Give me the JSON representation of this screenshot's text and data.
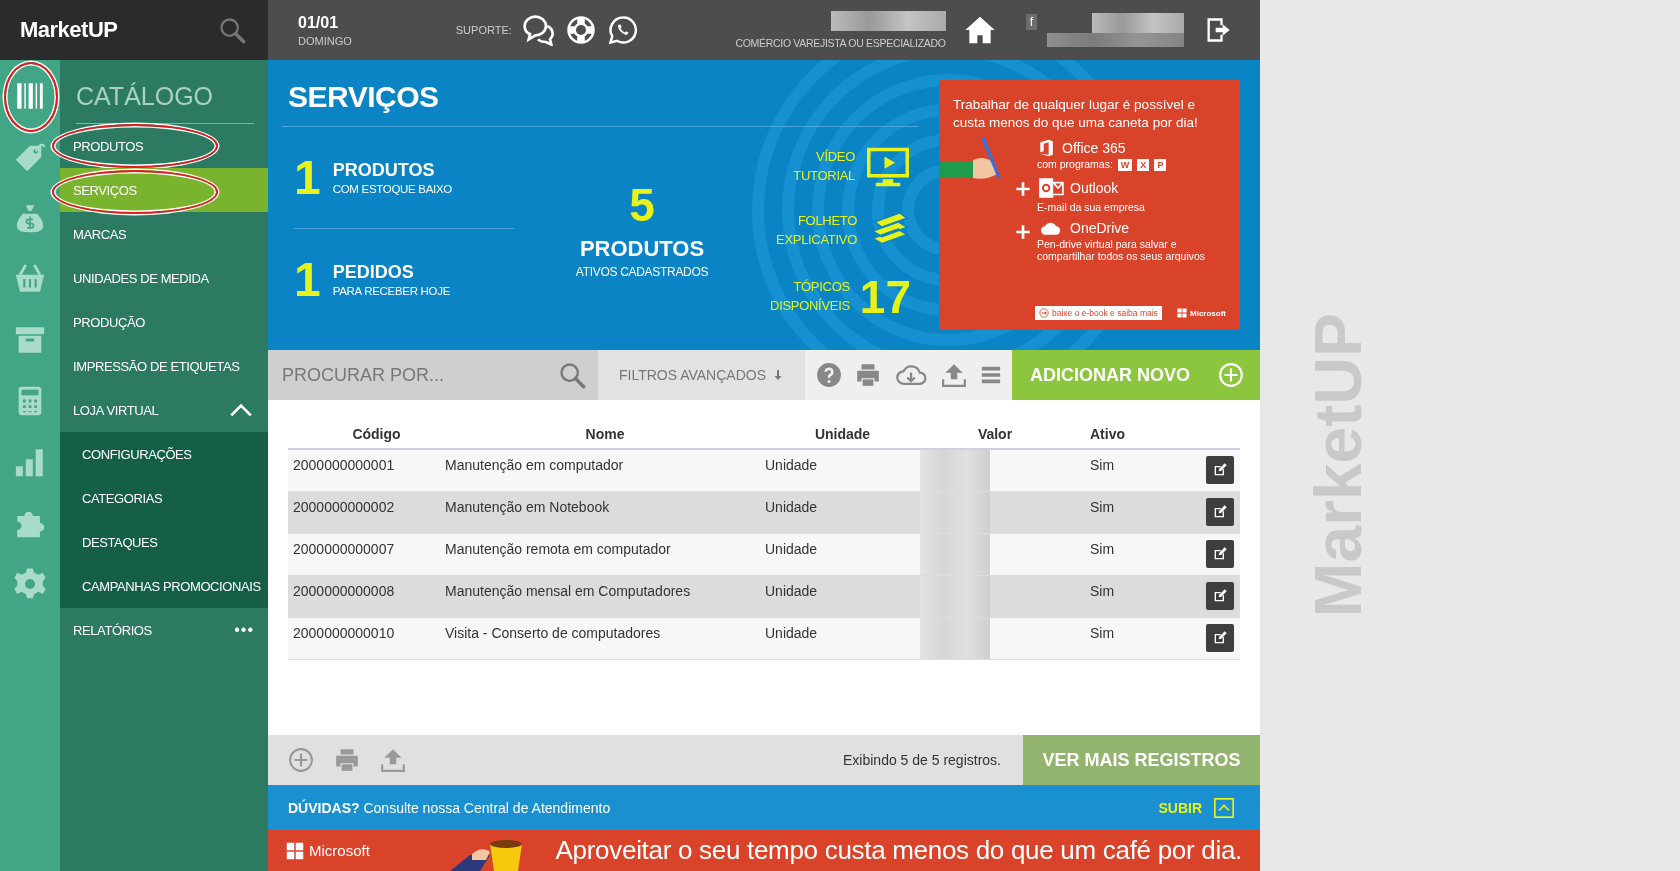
{
  "topbar": {
    "logo": "MarketUP",
    "date": "01/01",
    "weekday": "DOMINGO",
    "support_label": "SUPORTE:",
    "business_type": "COMÉRCIO VAREJISTA OU ESPECIALIZADO",
    "facebook": "f"
  },
  "rail": [
    {
      "kind": "barcode",
      "selected": true,
      "circled": true
    },
    {
      "kind": "tag",
      "selected": false,
      "circled": false
    },
    {
      "kind": "moneybag",
      "selected": false,
      "circled": false
    },
    {
      "kind": "basket",
      "selected": false,
      "circled": false
    },
    {
      "kind": "archive",
      "selected": false,
      "circled": false
    },
    {
      "kind": "calculator",
      "selected": false,
      "circled": false
    },
    {
      "kind": "chart",
      "selected": false,
      "circled": false
    },
    {
      "kind": "puzzle",
      "selected": false,
      "circled": false
    },
    {
      "kind": "gear",
      "selected": false,
      "circled": false
    }
  ],
  "menu": {
    "title": "CATÁLOGO",
    "items": [
      {
        "label": "PRODUTOS",
        "selected": false,
        "circled": true
      },
      {
        "label": "SERVIÇOS",
        "selected": true,
        "circled": true
      },
      {
        "label": "MARCAS",
        "selected": false,
        "circled": false
      },
      {
        "label": "UNIDADES DE MEDIDA",
        "selected": false,
        "circled": false
      },
      {
        "label": "PRODUÇÃO",
        "selected": false,
        "circled": false
      },
      {
        "label": "IMPRESSÃO DE ETIQUETAS",
        "selected": false,
        "circled": false
      },
      {
        "label": "LOJA VIRTUAL",
        "selected": false,
        "circled": false,
        "expanded": true,
        "children": [
          {
            "label": "CONFIGURAÇÕES",
            "selected": false
          },
          {
            "label": "CATEGORIAS",
            "selected": false
          },
          {
            "label": "DESTAQUES",
            "selected": false
          },
          {
            "label": "CAMPANHAS PROMOCIONAIS",
            "selected": false
          }
        ]
      },
      {
        "label": "RELATÓRIOS",
        "selected": false,
        "circled": false,
        "more": "•••"
      }
    ]
  },
  "header": {
    "title": "SERVIÇOS",
    "stats": [
      {
        "number": "1",
        "title": "PRODUTOS",
        "subtitle": "COM ESTOQUE BAIXO"
      },
      {
        "number": "1",
        "title": "PEDIDOS",
        "subtitle": "PARA RECEBER HOJE"
      }
    ],
    "total": {
      "number": "5",
      "title": "PRODUTOS",
      "subtitle": "ATIVOS CADASTRADOS"
    },
    "links": [
      {
        "kind": "video",
        "label": "VÍDEO TUTORIAL"
      },
      {
        "kind": "brochure",
        "label": "FOLHETO EXPLICATIVO"
      },
      {
        "kind": "topics",
        "label": "TÓPICOS DISPONÍVEIS",
        "number": "17"
      }
    ]
  },
  "ad": {
    "headline": "Trabalhar de qualquer lugar é possível e custa menos do que uma caneta por dia!",
    "products": [
      {
        "kind": "office",
        "name": "Office 365",
        "desc": "com programas:",
        "apps": [
          "W",
          "X",
          "P"
        ]
      },
      {
        "kind": "outlook",
        "name": "Outlook",
        "desc": "E-mail da sua empresa"
      },
      {
        "kind": "onedrive",
        "name": "OneDrive",
        "desc": "Pen-drive virtual para salvar e compartilhar todos os seus arquivos"
      }
    ],
    "button": "baixe o e-book e saiba mais",
    "brand": "Microsoft"
  },
  "toolbar": {
    "search_placeholder": "PROCURAR POR...",
    "filters": "FILTROS AVANÇADOS",
    "add_button": "ADICIONAR NOVO"
  },
  "table": {
    "columns": [
      "Código",
      "Nome",
      "Unidade",
      "Valor",
      "Ativo"
    ],
    "rows": [
      {
        "code": "2000000000001",
        "name": "Manutenção em computador",
        "unit": "Unidade",
        "active": "Sim"
      },
      {
        "code": "2000000000002",
        "name": "Manutenção em Notebook",
        "unit": "Unidade",
        "active": "Sim"
      },
      {
        "code": "2000000000007",
        "name": "Manutenção remota em computador",
        "unit": "Unidade",
        "active": "Sim"
      },
      {
        "code": "2000000000008",
        "name": "Manutenção mensal em Computadores",
        "unit": "Unidade",
        "active": "Sim"
      },
      {
        "code": "2000000000010",
        "name": "Visita - Conserto de computadores",
        "unit": "Unidade",
        "active": "Sim"
      }
    ]
  },
  "footer": {
    "count": "Exibindo 5 de 5 registros.",
    "more_button": "VER MAIS REGISTROS"
  },
  "help": {
    "text": "**DÚVIDAS?** Consulte nossa Central de Atendimento",
    "top": "SUBIR"
  },
  "banner": {
    "brand": "Microsoft",
    "text": "Aproveitar o seu tempo custa menos do que um café por dia."
  },
  "background_logo": "MarketUP"
}
